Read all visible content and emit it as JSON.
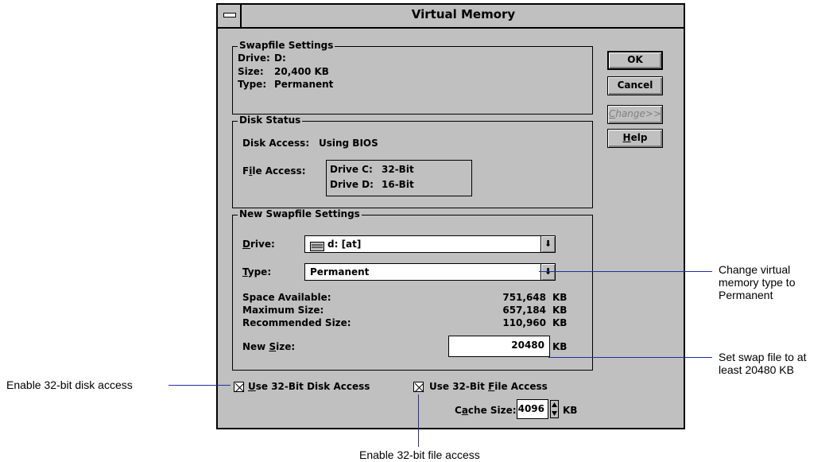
{
  "window": {
    "title": "Virtual Memory"
  },
  "swapfile_settings": {
    "caption": "Swapfile Settings",
    "drive_label": "Drive:",
    "drive_value": "D:",
    "size_label": "Size:",
    "size_value": "20,400 KB",
    "type_label": "Type:",
    "type_value": "Permanent"
  },
  "disk_status": {
    "caption": "Disk Status",
    "disk_access_label": "Disk Access:",
    "disk_access_value": "Using BIOS",
    "file_access_label_pre": "F",
    "file_access_label_u": "i",
    "file_access_label_post": "le Access:",
    "file_access_rows": [
      {
        "drive": "Drive C:",
        "mode": "32-Bit"
      },
      {
        "drive": "Drive D:",
        "mode": "16-Bit"
      }
    ]
  },
  "new_swapfile": {
    "caption": "New Swapfile Settings",
    "drive_label_u": "D",
    "drive_label_post": "rive:",
    "drive_value": "d: [at]",
    "type_label_u": "T",
    "type_label_post": "ype:",
    "type_value": "Permanent",
    "space_available_label": "Space Available:",
    "space_available_value": "751,648",
    "space_available_unit": "KB",
    "max_size_label": "Maximum Size:",
    "max_size_value": "657,184",
    "max_size_unit": "KB",
    "recommended_label": "Recommended Size:",
    "recommended_value": "110,960",
    "recommended_unit": "KB",
    "new_size_label_pre": "New ",
    "new_size_label_u": "S",
    "new_size_label_post": "ize:",
    "new_size_value": "20480",
    "new_size_unit": "KB"
  },
  "buttons": {
    "ok": "OK",
    "cancel": "Cancel",
    "change_u": "C",
    "change_post": "hange>>",
    "help_u": "H",
    "help_post": "elp"
  },
  "options": {
    "disk_access_u": "U",
    "disk_access_post": "se 32-Bit Disk Access",
    "file_access_pre": "Use 32-Bit ",
    "file_access_u": "F",
    "file_access_post": "ile Access",
    "cache_pre": "C",
    "cache_u": "a",
    "cache_post": "che Size:",
    "cache_value": "4096",
    "cache_unit": "KB"
  },
  "annotations": {
    "change_type": "Change virtual memory type to Permanent",
    "change_type_l1": "Change virtual",
    "change_type_l2": "memory type to",
    "change_type_l3": "Permanent",
    "set_swap_l1": "Set swap file to at",
    "set_swap_l2": "least 20480 KB",
    "disk_access": "Enable 32-bit disk access",
    "file_access": "Enable 32-bit file access"
  },
  "colors": {
    "face": "#c0c0c0",
    "callout_line": "#2030a0"
  }
}
